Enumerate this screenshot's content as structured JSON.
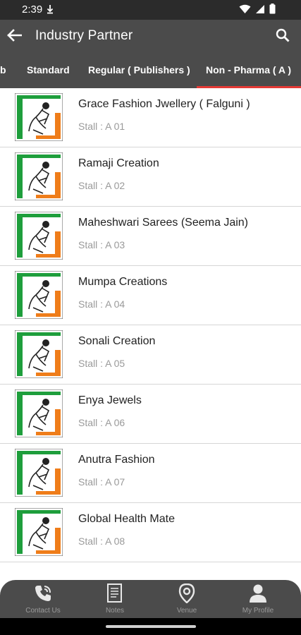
{
  "status_bar": {
    "time": "2:39",
    "icons": [
      "download-arrow-icon",
      "wifi-icon",
      "signal-icon",
      "battery-icon"
    ]
  },
  "app_bar": {
    "title": "Industry Partner",
    "back_icon": "back-arrow-icon",
    "search_icon": "search-icon"
  },
  "tabs": [
    {
      "label": "b",
      "selected": false
    },
    {
      "label": "Standard",
      "selected": false
    },
    {
      "label": "Regular ( Publishers )",
      "selected": false
    },
    {
      "label": "Non - Pharma ( A )",
      "selected": true
    }
  ],
  "partners": [
    {
      "name": "Grace Fashion Jwellery ( Falguni )",
      "stall": "Stall : A 01"
    },
    {
      "name": "Ramaji Creation",
      "stall": "Stall : A 02"
    },
    {
      "name": "Maheshwari Sarees (Seema Jain)",
      "stall": "Stall : A 03"
    },
    {
      "name": "Mumpa Creations",
      "stall": "Stall : A 04"
    },
    {
      "name": "Sonali Creation",
      "stall": "Stall : A 05"
    },
    {
      "name": "Enya Jewels",
      "stall": "Stall : A 06"
    },
    {
      "name": "Anutra Fashion",
      "stall": "Stall : A 07"
    },
    {
      "name": "Global Health Mate",
      "stall": "Stall : A 08"
    }
  ],
  "bottom_nav": [
    {
      "label": "Contact Us",
      "icon": "phone-icon"
    },
    {
      "label": "Notes",
      "icon": "notes-icon"
    },
    {
      "label": "Venue",
      "icon": "location-pin-icon"
    },
    {
      "label": "My Profile",
      "icon": "profile-icon"
    }
  ],
  "colors": {
    "bar": "#4b4b4b",
    "status_bar": "#2b2b2b",
    "tab_indicator": "#e53935",
    "logo_green": "#1e9e3c",
    "logo_orange": "#ef7d1a",
    "nav_inactive": "#9a9a9a"
  }
}
